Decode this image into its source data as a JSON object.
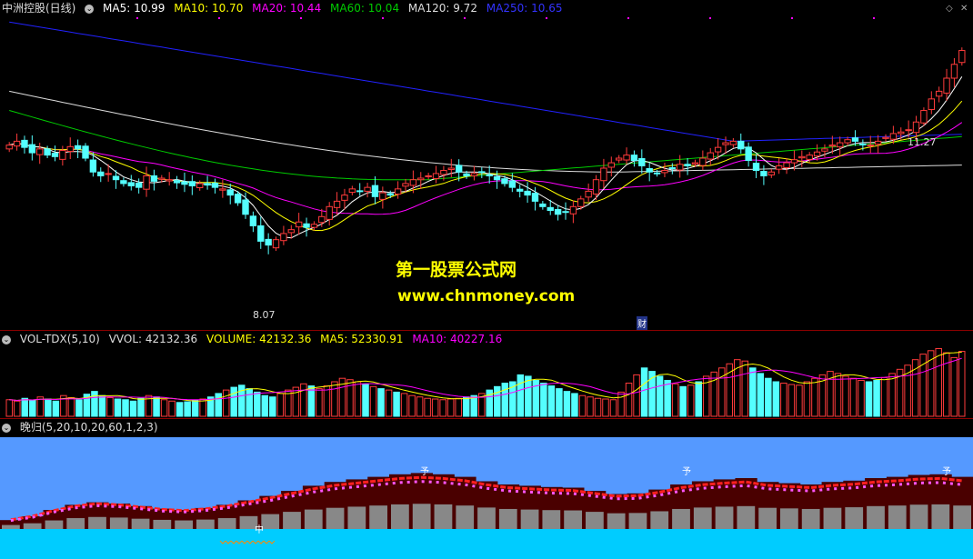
{
  "price_header": {
    "title": "中洲控股(日线)",
    "ma5": "MA5: 10.99",
    "ma10": "MA10: 10.70",
    "ma20": "MA20: 10.44",
    "ma60": "MA60: 10.04",
    "ma120": "MA120: 9.72",
    "ma250": "MA250: 10.65"
  },
  "vol_header": {
    "name": "VOL-TDX(5,10)",
    "vvol": "VVOL: 42132.36",
    "volume": "VOLUME: 42132.36",
    "ma5": "MA5: 52330.91",
    "ma10": "MA10: 40227.16"
  },
  "ind_header": {
    "name": "晚归(5,20,10,20,60,1,2,3)"
  },
  "annotations": {
    "high": "11.27",
    "low": "8.07",
    "cai": "财",
    "ind_marker": "中",
    "ind_arrow": "予"
  },
  "watermark": {
    "line1": "第一股票公式网",
    "line2": "www.chnmoney.com"
  },
  "colors": {
    "up": "#ff3b3b",
    "down": "#54ffff",
    "ma5": "#ffffff",
    "ma10": "#ffff00",
    "ma20": "#ff00ff",
    "ma60": "#00cc00",
    "ma120": "#dddddd",
    "ma250": "#2222ff",
    "ind_bg": "#5599ff",
    "ind_base": "#00ccff",
    "ind_dark": "#4a0000",
    "ind_gray": "#888888"
  },
  "chart_data": [
    {
      "type": "candlestick",
      "title": "中洲控股(日线)",
      "ylim": [
        7.7,
        11.6
      ],
      "closes": [
        9.95,
        10.0,
        9.92,
        9.85,
        9.9,
        9.82,
        9.8,
        9.88,
        9.93,
        9.9,
        9.78,
        9.6,
        9.55,
        9.58,
        9.5,
        9.45,
        9.42,
        9.4,
        9.55,
        9.48,
        9.52,
        9.5,
        9.46,
        9.44,
        9.42,
        9.45,
        9.43,
        9.4,
        9.38,
        9.3,
        9.2,
        9.05,
        8.9,
        8.7,
        8.65,
        8.72,
        8.8,
        8.85,
        8.95,
        8.88,
        8.92,
        9.02,
        9.15,
        9.22,
        9.3,
        9.38,
        9.35,
        9.4,
        9.28,
        9.33,
        9.3,
        9.38,
        9.45,
        9.5,
        9.52,
        9.55,
        9.58,
        9.62,
        9.65,
        9.6,
        9.55,
        9.58,
        9.6,
        9.55,
        9.5,
        9.45,
        9.4,
        9.35,
        9.3,
        9.22,
        9.15,
        9.1,
        9.05,
        9.08,
        9.15,
        9.25,
        9.35,
        9.5,
        9.65,
        9.72,
        9.78,
        9.82,
        9.75,
        9.68,
        9.6,
        9.58,
        9.62,
        9.65,
        9.7,
        9.68,
        9.72,
        9.78,
        9.85,
        9.92,
        9.98,
        10.0,
        9.9,
        9.75,
        9.62,
        9.55,
        9.6,
        9.68,
        9.72,
        9.76,
        9.8,
        9.82,
        9.86,
        9.9,
        9.95,
        9.98,
        10.02,
        10.0,
        9.96,
        9.95,
        10.0,
        10.05,
        10.1,
        10.12,
        10.15,
        10.25,
        10.4,
        10.55,
        10.65,
        10.82,
        11.0,
        11.18
      ]
    },
    {
      "type": "bar",
      "title": "VOL-TDX(5,10)",
      "values": [
        24,
        22,
        26,
        23,
        28,
        25,
        22,
        30,
        27,
        24,
        32,
        36,
        30,
        27,
        25,
        24,
        22,
        26,
        30,
        28,
        24,
        22,
        20,
        21,
        23,
        25,
        28,
        33,
        38,
        42,
        45,
        40,
        35,
        30,
        28,
        33,
        38,
        42,
        47,
        44,
        40,
        44,
        50,
        55,
        53,
        50,
        47,
        43,
        40,
        38,
        35,
        33,
        30,
        28,
        26,
        25,
        24,
        25,
        26,
        28,
        30,
        33,
        38,
        43,
        48,
        50,
        60,
        58,
        52,
        48,
        44,
        40,
        36,
        33,
        30,
        28,
        26,
        25,
        24,
        35,
        48,
        60,
        70,
        65,
        58,
        52,
        47,
        43,
        45,
        50,
        58,
        64,
        70,
        76,
        82,
        80,
        70,
        62,
        55,
        50,
        48,
        46,
        45,
        50,
        55,
        60,
        65,
        62,
        58,
        55,
        52,
        50,
        52,
        56,
        62,
        68,
        74,
        82,
        90,
        95,
        98,
        92,
        85,
        94
      ]
    },
    {
      "type": "area",
      "title": "晚归(5,20,10,20,60,1,2,3)",
      "series": [
        {
          "values": [
            0.14,
            0.2,
            0.3,
            0.38,
            0.42,
            0.4,
            0.36,
            0.32,
            0.3,
            0.33,
            0.38,
            0.45,
            0.52,
            0.6,
            0.68,
            0.74,
            0.78,
            0.82,
            0.86,
            0.88,
            0.86,
            0.82,
            0.75,
            0.7,
            0.68,
            0.66,
            0.65,
            0.6,
            0.55,
            0.56,
            0.62,
            0.7,
            0.75,
            0.78,
            0.8,
            0.74,
            0.72,
            0.7,
            0.74,
            0.76,
            0.8,
            0.82,
            0.85,
            0.86,
            0.82
          ]
        }
      ]
    }
  ]
}
